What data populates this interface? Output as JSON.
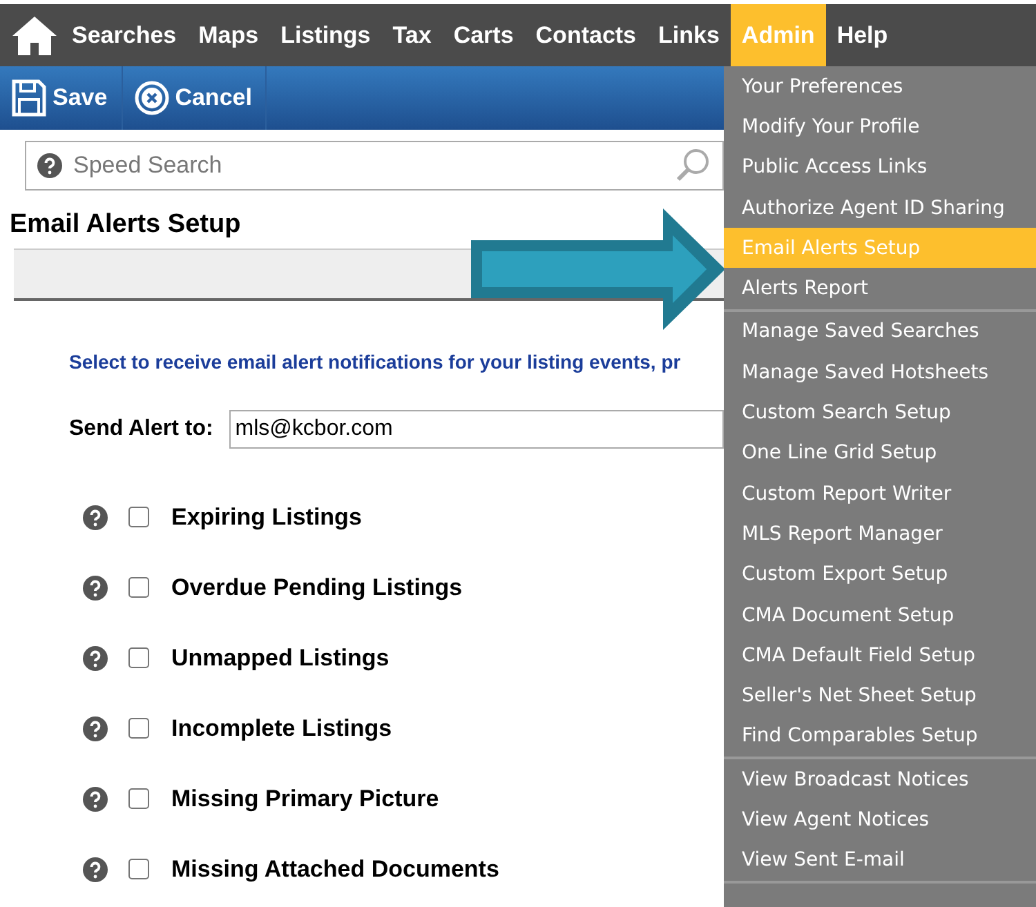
{
  "nav": {
    "items": [
      {
        "label": "Searches",
        "selected": false
      },
      {
        "label": "Maps",
        "selected": false
      },
      {
        "label": "Listings",
        "selected": false
      },
      {
        "label": "Tax",
        "selected": false
      },
      {
        "label": "Carts",
        "selected": false
      },
      {
        "label": "Contacts",
        "selected": false
      },
      {
        "label": "Links",
        "selected": false
      },
      {
        "label": "Admin",
        "selected": true
      },
      {
        "label": "Help",
        "selected": false
      }
    ]
  },
  "toolbar": {
    "save": "Save",
    "cancel": "Cancel"
  },
  "search": {
    "placeholder": "Speed Search"
  },
  "page_title": "Email Alerts Setup",
  "instructions": "Select to receive email alert notifications for your listing events, pr",
  "send_alert": {
    "label": "Send Alert to:",
    "value": "mls@kcbor.com"
  },
  "alerts": [
    {
      "label": "Expiring Listings",
      "checked": false
    },
    {
      "label": "Overdue Pending Listings",
      "checked": false
    },
    {
      "label": "Unmapped Listings",
      "checked": false
    },
    {
      "label": "Incomplete Listings",
      "checked": false
    },
    {
      "label": "Missing Primary Picture",
      "checked": false
    },
    {
      "label": "Missing Attached Documents",
      "checked": false
    }
  ],
  "admin_menu": {
    "groups": [
      [
        {
          "label": "Your Preferences",
          "selected": false
        },
        {
          "label": "Modify Your Profile",
          "selected": false
        },
        {
          "label": "Public Access Links",
          "selected": false
        },
        {
          "label": "Authorize Agent ID Sharing",
          "selected": false
        },
        {
          "label": "Email Alerts Setup",
          "selected": true
        },
        {
          "label": "Alerts Report",
          "selected": false
        }
      ],
      [
        {
          "label": "Manage Saved Searches",
          "selected": false
        },
        {
          "label": "Manage Saved Hotsheets",
          "selected": false
        },
        {
          "label": "Custom Search Setup",
          "selected": false
        },
        {
          "label": "One Line Grid Setup",
          "selected": false
        },
        {
          "label": "Custom Report Writer",
          "selected": false
        },
        {
          "label": "MLS Report Manager",
          "selected": false
        },
        {
          "label": "Custom Export Setup",
          "selected": false
        },
        {
          "label": "CMA Document Setup",
          "selected": false
        },
        {
          "label": "CMA Default Field Setup",
          "selected": false
        },
        {
          "label": "Seller's Net Sheet Setup",
          "selected": false
        },
        {
          "label": "Find Comparables Setup",
          "selected": false
        }
      ],
      [
        {
          "label": "View Broadcast Notices",
          "selected": false
        },
        {
          "label": "View Agent Notices",
          "selected": false
        },
        {
          "label": "View Sent E-mail",
          "selected": false
        }
      ]
    ]
  }
}
